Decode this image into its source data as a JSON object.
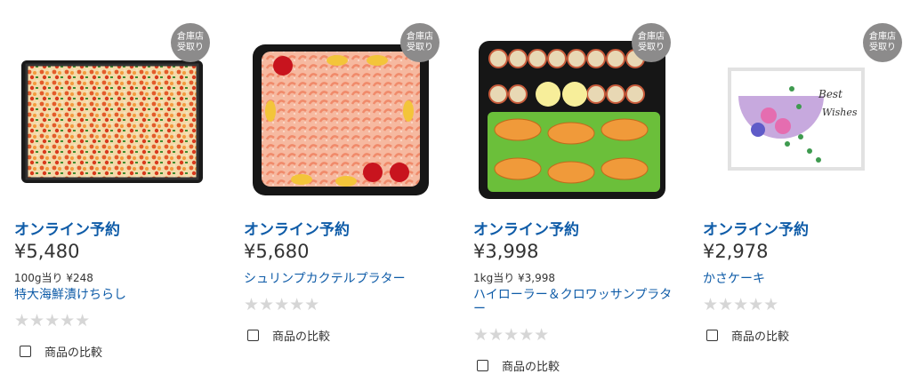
{
  "products": [
    {
      "badge": [
        "倉庫店",
        "受取り"
      ],
      "online_label": "オンライン予約",
      "price": "¥5,480",
      "unit_price": "100g当り ¥248",
      "name": "特大海鮮漬けちらし",
      "stars": "★★★★★",
      "compare_label": "商品の比較"
    },
    {
      "badge": [
        "倉庫店",
        "受取り"
      ],
      "online_label": "オンライン予約",
      "price": "¥5,680",
      "unit_price": "",
      "name": "シュリンプカクテルプラター",
      "stars": "★★★★★",
      "compare_label": "商品の比較"
    },
    {
      "badge": [
        "倉庫店",
        "受取り"
      ],
      "online_label": "オンライン予約",
      "price": "¥3,998",
      "unit_price": "1kg当り ¥3,998",
      "name": "ハイローラー＆クロワッサンプラター",
      "stars": "★★★★★",
      "compare_label": "商品の比較"
    },
    {
      "badge": [
        "倉庫店",
        "受取り"
      ],
      "online_label": "オンライン予約",
      "price": "¥2,978",
      "unit_price": "",
      "name": "かさケーキ",
      "stars": "★★★★★",
      "compare_label": "商品の比較",
      "cake_text": [
        "Best",
        "Wishes"
      ]
    }
  ],
  "colors": {
    "link": "#0f5ca8",
    "badge": "#8c8b8b",
    "star_empty": "#d6d6d6"
  }
}
